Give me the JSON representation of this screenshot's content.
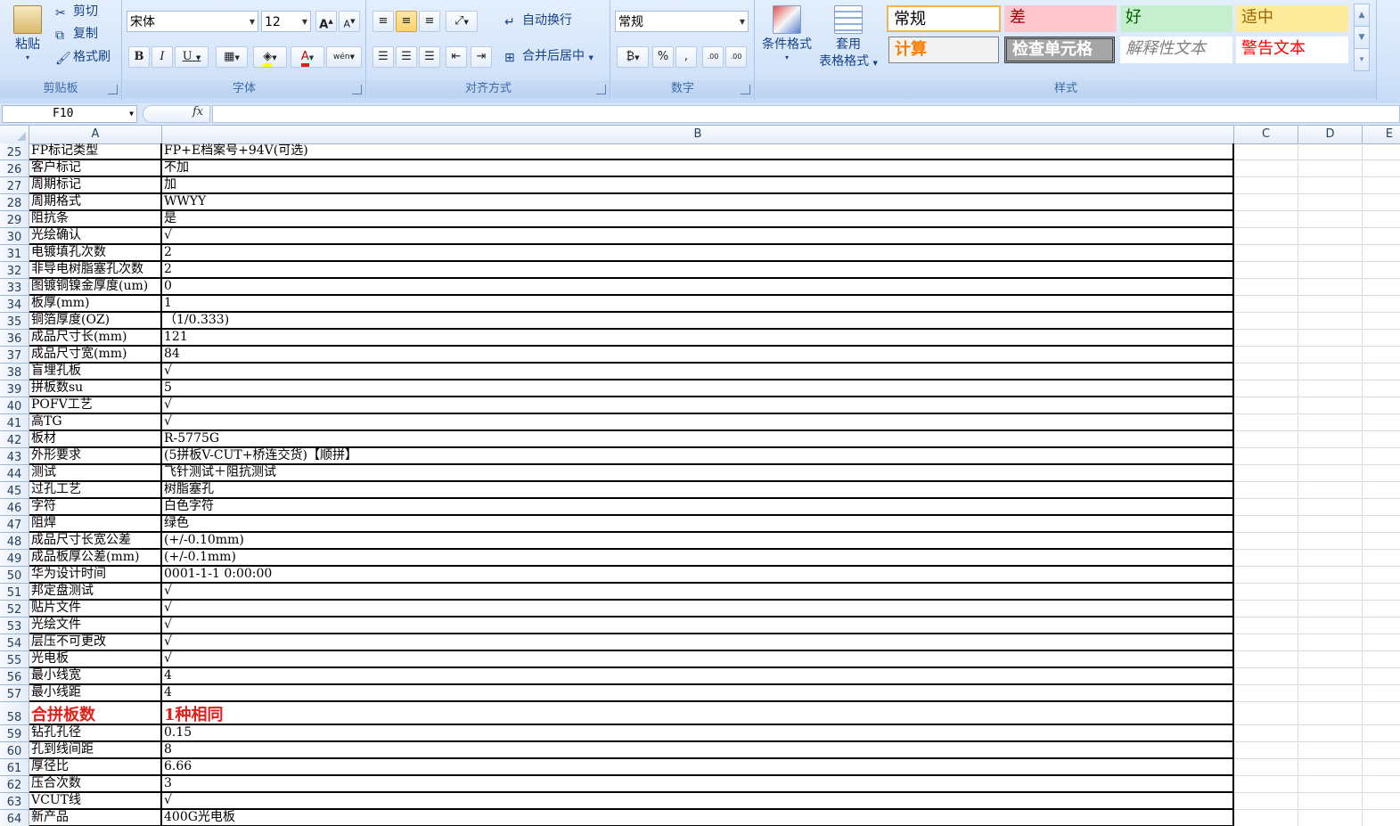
{
  "ribbon": {
    "clipboard": {
      "paste": "粘贴",
      "cut": "剪切",
      "copy": "复制",
      "format_painter": "格式刷",
      "label": "剪贴板"
    },
    "font": {
      "name": "宋体",
      "size": "12",
      "grow": "A",
      "shrink": "A",
      "bold": "B",
      "italic": "I",
      "underline": "U",
      "font_color": "A",
      "phonetic": "wén",
      "label": "字体"
    },
    "alignment": {
      "wrap_text": "自动换行",
      "merge_center": "合并后居中",
      "label": "对齐方式"
    },
    "number": {
      "format": "常规",
      "percent": "%",
      "comma": ",",
      "inc_decimal": ".00",
      "dec_decimal": ".00",
      "label": "数字"
    },
    "styles": {
      "conditional_format": "条件格式",
      "table_format_1": "套用",
      "table_format_2": "表格格式",
      "label": "样式",
      "cells": [
        {
          "text": "常规"
        },
        {
          "text": "差"
        },
        {
          "text": "好"
        },
        {
          "text": "适中"
        },
        {
          "text": "计算"
        },
        {
          "text": "检查单元格"
        },
        {
          "text": "解释性文本"
        },
        {
          "text": "警告文本"
        }
      ]
    }
  },
  "formula_bar": {
    "name_box": "F10",
    "fx": "fx",
    "content": ""
  },
  "columns": [
    "A",
    "B",
    "C",
    "D",
    "E"
  ],
  "rows": [
    {
      "num": "25",
      "a": "FP标记类型",
      "b": "FP+E档案号+94V(可选)"
    },
    {
      "num": "26",
      "a": "客户标记",
      "b": "不加"
    },
    {
      "num": "27",
      "a": "周期标记",
      "b": "加"
    },
    {
      "num": "28",
      "a": "周期格式",
      "b": "WWYY"
    },
    {
      "num": "29",
      "a": "阻抗条",
      "b": "是"
    },
    {
      "num": "30",
      "a": "光绘确认",
      "b": "√"
    },
    {
      "num": "31",
      "a": "电镀填孔次数",
      "b": "2"
    },
    {
      "num": "32",
      "a": "非导电树脂塞孔次数",
      "b": "2"
    },
    {
      "num": "33",
      "a": "图镀铜镍金厚度(um)",
      "b": "0"
    },
    {
      "num": "34",
      "a": "板厚(mm)",
      "b": "1"
    },
    {
      "num": "35",
      "a": "铜箔厚度(OZ)",
      "b": "（1/0.333)"
    },
    {
      "num": "36",
      "a": "成品尺寸长(mm)",
      "b": "121"
    },
    {
      "num": "37",
      "a": "成品尺寸宽(mm)",
      "b": "84"
    },
    {
      "num": "38",
      "a": "盲埋孔板",
      "b": "√"
    },
    {
      "num": "39",
      "a": "拼板数su",
      "b": "5"
    },
    {
      "num": "40",
      "a": "POFV工艺",
      "b": "√"
    },
    {
      "num": "41",
      "a": "高TG",
      "b": "√"
    },
    {
      "num": "42",
      "a": "板材",
      "b": "R-5775G"
    },
    {
      "num": "43",
      "a": "外形要求",
      "b": "(5拼板V-CUT+桥连交货)【顺拼】"
    },
    {
      "num": "44",
      "a": "测试",
      "b": "飞针测试＋阻抗测试"
    },
    {
      "num": "45",
      "a": "过孔工艺",
      "b": "树脂塞孔"
    },
    {
      "num": "46",
      "a": "字符",
      "b": "白色字符"
    },
    {
      "num": "47",
      "a": "阻焊",
      "b": "绿色"
    },
    {
      "num": "48",
      "a": "成品尺寸长宽公差",
      "b": "(+/-0.10mm)"
    },
    {
      "num": "49",
      "a": "成品板厚公差(mm)",
      "b": "(+/-0.1mm)"
    },
    {
      "num": "50",
      "a": "华为设计时间",
      "b": "0001-1-1 0:00:00"
    },
    {
      "num": "51",
      "a": "邦定盘测试",
      "b": "√"
    },
    {
      "num": "52",
      "a": "贴片文件",
      "b": "√"
    },
    {
      "num": "53",
      "a": "光绘文件",
      "b": "√"
    },
    {
      "num": "54",
      "a": "层压不可更改",
      "b": "√"
    },
    {
      "num": "55",
      "a": "光电板",
      "b": "√"
    },
    {
      "num": "56",
      "a": "最小线宽",
      "b": "4"
    },
    {
      "num": "57",
      "a": "最小线距",
      "b": "4"
    },
    {
      "num": "58",
      "a": "合拼板数",
      "b": "1种相同",
      "highlight": true
    },
    {
      "num": "59",
      "a": "钻孔孔径",
      "b": "0.15"
    },
    {
      "num": "60",
      "a": "孔到线间距",
      "b": "8"
    },
    {
      "num": "61",
      "a": "厚径比",
      "b": "6.66"
    },
    {
      "num": "62",
      "a": "压合次数",
      "b": "3"
    },
    {
      "num": "63",
      "a": "VCUT线",
      "b": "√"
    },
    {
      "num": "64",
      "a": "新产品",
      "b": "400G光电板"
    }
  ],
  "colors": {
    "highlight_text": "#e0201a",
    "ribbon_bg": "#d5e5fa",
    "grid_border": "#000000"
  }
}
